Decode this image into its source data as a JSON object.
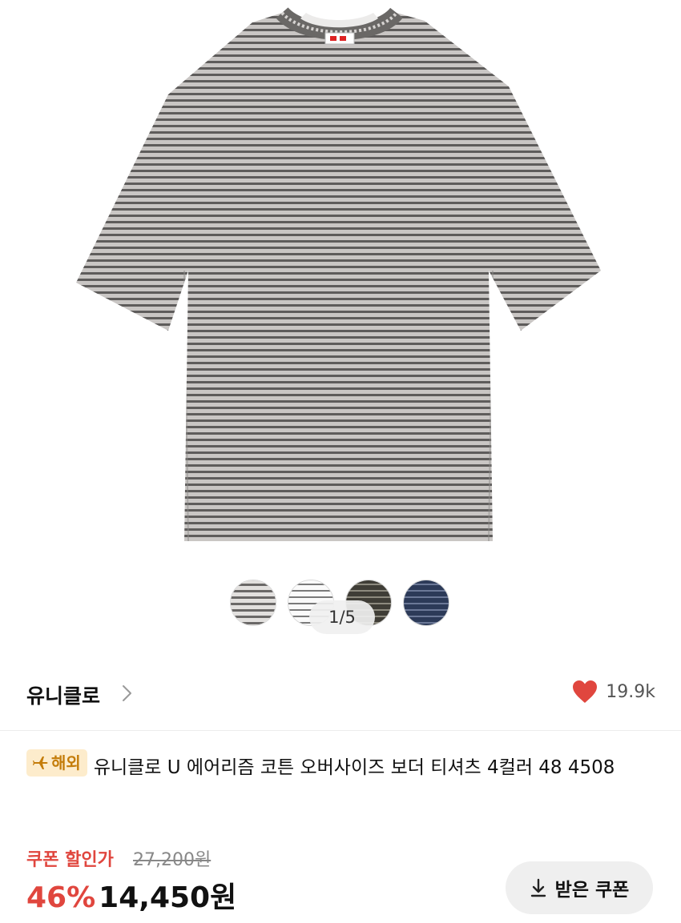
{
  "product": {
    "page_indicator": "1/5",
    "swatch_colors": [
      "#8a8a8a",
      "#f2f2f2",
      "#4a4a40",
      "#2f3e5c"
    ]
  },
  "brand": {
    "name": "유니클로",
    "like_count": "19.9k"
  },
  "title": {
    "badge": "해외",
    "text": "유니클로 U 에어리즘 코튼 오버사이즈 보더 티셔츠 4컬러 48 4508"
  },
  "pricing": {
    "coupon_label": "쿠폰 할인가",
    "original_price": "27,200원",
    "discount": "46%",
    "final_price": "14,450원",
    "coupon_button": "받은 쿠폰"
  },
  "colors": {
    "accent_red": "#e0463e",
    "badge_bg": "#fdeccc",
    "badge_text": "#c47c09"
  }
}
